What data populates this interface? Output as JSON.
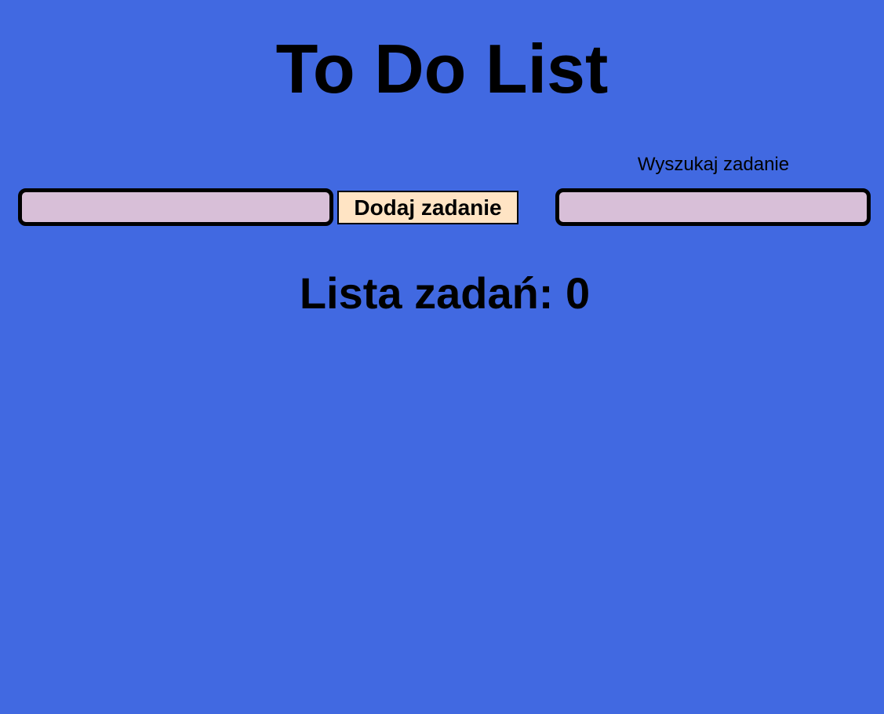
{
  "app": {
    "title": "To Do List"
  },
  "add_task": {
    "input_value": "",
    "input_placeholder": "",
    "button_label": "Dodaj zadanie"
  },
  "search": {
    "label": "Wyszukaj zadanie",
    "input_value": "",
    "input_placeholder": ""
  },
  "task_list": {
    "heading_label": "Lista zadań:",
    "count": 0,
    "items": []
  },
  "colors": {
    "background": "#4169e1",
    "input_fill": "#d8bfd8",
    "button_fill": "#ffe4c4",
    "border": "#000000"
  }
}
